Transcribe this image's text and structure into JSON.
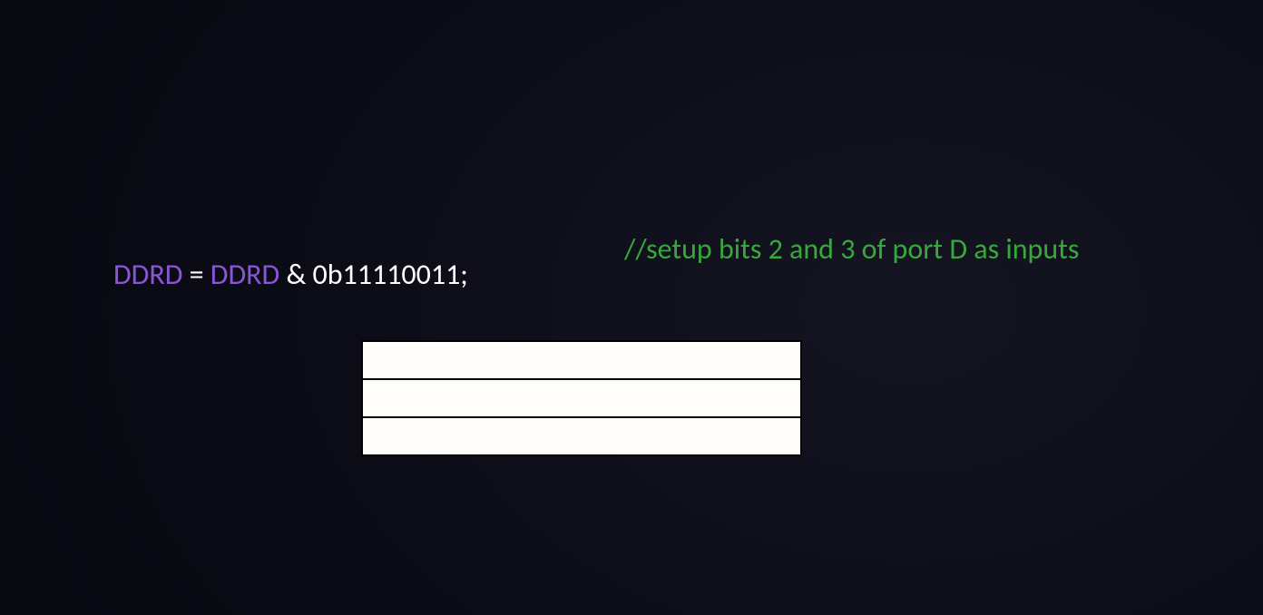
{
  "code": {
    "lhs_identifier": "DDRD",
    "equals": " = ",
    "rhs_identifier": "DDRD",
    "operator_and_literal": " & 0b11110011;"
  },
  "comment": "//setup bits 2 and 3 of port D as inputs",
  "table": {
    "rows": [
      {
        "cells": [
          ""
        ]
      },
      {
        "cells": [
          ""
        ]
      },
      {
        "cells": [
          ""
        ]
      }
    ]
  },
  "colors": {
    "identifier": "#8b55d7",
    "operator_text": "#ffffff",
    "comment": "#37a93c",
    "table_cell_bg": "#fffefa",
    "table_border": "#000000"
  }
}
